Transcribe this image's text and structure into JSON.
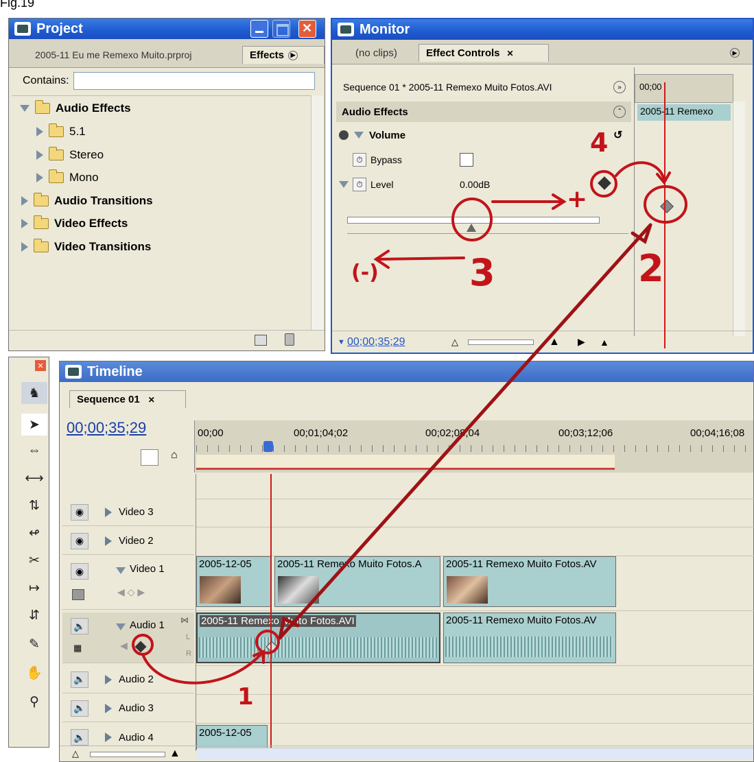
{
  "fig_label": "Fig.19",
  "project_panel": {
    "title": "Project",
    "tabs": [
      "2005-11 Eu me Remexo Muito.prproj",
      "Effects"
    ],
    "contains_label": "Contains:",
    "contains_value": "",
    "tree": [
      {
        "label": "Audio Effects",
        "level": 0,
        "expanded": true,
        "bold": true
      },
      {
        "label": "5.1",
        "level": 1,
        "expanded": false,
        "bold": false
      },
      {
        "label": "Stereo",
        "level": 1,
        "expanded": false,
        "bold": false
      },
      {
        "label": "Mono",
        "level": 1,
        "expanded": false,
        "bold": false
      },
      {
        "label": "Audio Transitions",
        "level": 0,
        "expanded": false,
        "bold": true
      },
      {
        "label": "Video Effects",
        "level": 0,
        "expanded": false,
        "bold": true
      },
      {
        "label": "Video Transitions",
        "level": 0,
        "expanded": false,
        "bold": true
      }
    ]
  },
  "monitor_panel": {
    "title": "Monitor",
    "tabs": [
      "(no clips)",
      "Effect Controls"
    ],
    "sequence_label": "Sequence 01 * 2005-11 Remexo Muito Fotos.AVI",
    "mini_timecode": "00;00",
    "mini_clip": "2005-11 Remexo",
    "section": "Audio Effects",
    "effect_name": "Volume",
    "params": [
      {
        "name": "Bypass",
        "value": ""
      },
      {
        "name": "Level",
        "value": "0.00dB"
      }
    ],
    "timecode": "00;00;35;29"
  },
  "timeline_panel": {
    "title": "Timeline",
    "sequence_tab": "Sequence 01",
    "timecode": "00;00;35;29",
    "ruler_ticks": [
      "00;00",
      "00;01;04;02",
      "00;02;08;04",
      "00;03;12;06",
      "00;04;16;08"
    ],
    "tracks": [
      {
        "name": "Video 3",
        "kind": "video",
        "expanded": false
      },
      {
        "name": "Video 2",
        "kind": "video",
        "expanded": false
      },
      {
        "name": "Video 1",
        "kind": "video",
        "expanded": true
      },
      {
        "name": "Audio 1",
        "kind": "audio",
        "expanded": true
      },
      {
        "name": "Audio 2",
        "kind": "audio",
        "expanded": false
      },
      {
        "name": "Audio 3",
        "kind": "audio",
        "expanded": false
      },
      {
        "name": "Audio 4",
        "kind": "audio",
        "expanded": false
      }
    ],
    "clips": {
      "v1_a": "2005-12-05",
      "v1_b": "2005-11 Remexo Muito Fotos.A",
      "v1_c": "2005-11 Remexo Muito Fotos.AV",
      "a1_a": "2005-11 Remexo Muito Fotos.AVI",
      "a1_b": "2005-11 Remexo Muito Fotos.AV",
      "a4_a": "2005-12-05"
    },
    "channel_l": "L",
    "channel_r": "R"
  },
  "annotations": [
    "1",
    "2",
    "3",
    "4",
    "(-)",
    "+"
  ],
  "colors": {
    "xp_blue": "#1e5bd0",
    "panel": "#ece9d8",
    "clip": "#aacfcf",
    "ink": "#c2141a",
    "playhead": "#d01818"
  }
}
